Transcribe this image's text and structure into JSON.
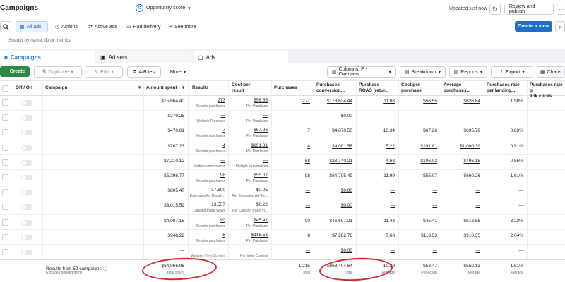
{
  "header": {
    "title": "Campaigns",
    "opportunity_badge": "72",
    "opportunity_label": "Opportunity score",
    "updated": "Updated just now",
    "review_publish": "Review and publish"
  },
  "filters": {
    "all_ads": "All ads",
    "actions": "Actions",
    "active_ads": "Active ads",
    "had_delivery": "Had delivery",
    "see_more": "See more",
    "create_view": "Create a view"
  },
  "search": {
    "placeholder": "Search by name, ID or metrics"
  },
  "tabs": {
    "campaigns": "Campaigns",
    "ad_sets": "Ad sets",
    "ads": "Ads"
  },
  "toolbar": {
    "create": "Create",
    "duplicate": "Duplicate",
    "edit": "Edit",
    "ab_test": "A/B test",
    "more": "More",
    "columns": "Columns: P - Overview",
    "breakdown": "Breakdown",
    "reports": "Reports",
    "export": "Export",
    "charts": "Charts"
  },
  "columns": {
    "off_on": "Off / On",
    "campaign": "Campaign",
    "amount_spent": "Amount spent",
    "results": "Results",
    "cost_per_result_1": "Cost per",
    "cost_per_result_2": "result",
    "purchases": "Purchases",
    "purchases_value_1": "Purchases",
    "purchases_value_2": "conversion...",
    "roas_1": "Purchase",
    "roas_2": "ROAS (retur...",
    "cost_per_purchase_1": "Cost per",
    "cost_per_purchase_2": "purchase",
    "avg_purchase_1": "Average",
    "avg_purchase_2": "purchases...",
    "rate_lp_1": "Purchases rate",
    "rate_lp_2": "per landing...",
    "rate_lc_1": "Purchases rate p",
    "rate_lc_2": "link clicks"
  },
  "rows": [
    {
      "spent": "$15,664.40",
      "results": "277",
      "results_type": "Website purchases",
      "cpr": "$56.55",
      "cpr_type": "Per Purchase",
      "purchases": "277",
      "value": "$173,634.44",
      "roas": "11.08",
      "cpp": "$56.55",
      "avg": "$626.84",
      "rate": "1.98%"
    },
    {
      "spent": "$279.25",
      "results": "—",
      "results_type": "Website Purchase",
      "cpr": "—",
      "cpr_type": "Per Purchase",
      "purchases": "—",
      "value": "$0.00",
      "roas": "—",
      "cpp": "—",
      "avg": "—",
      "rate": "—"
    },
    {
      "spent": "$470.81",
      "results": "7",
      "results_type": "Website purchases",
      "cpr": "$67.26",
      "cpr_type": "Per Purchase",
      "purchases": "7",
      "value": "$4,870.50",
      "roas": "10.34",
      "cpp": "$67.26",
      "avg": "$695.79",
      "rate": "0.83%"
    },
    {
      "spent": "$767.23",
      "results": "4",
      "results_type": "Website purchases",
      "cpr": "$191.81",
      "cpr_type": "Per Purchase",
      "purchases": "4",
      "value": "$4,001.56",
      "roas": "5.22",
      "cpp": "$191.81",
      "avg": "$1,000.39",
      "rate": "0.91%"
    },
    {
      "spent": "$7,210.12",
      "results": "—",
      "results_type": "Multiple conversions",
      "cpr": "—",
      "cpr_type": "Multiple conversions",
      "purchases": "68",
      "value": "$33,740.21",
      "roas": "4.68",
      "cpp": "$106.03",
      "avg": "$496.18",
      "rate": "0.55%"
    },
    {
      "spent": "$5,396.77",
      "results": "98",
      "results_type": "Website purchases",
      "cpr": "$55.07",
      "cpr_type": "Per Purchase",
      "purchases": "98",
      "value": "$64,705.49",
      "roas": "11.99",
      "cpp": "$55.07",
      "avg": "$660.26",
      "rate": "1.61%"
    },
    {
      "spent": "$805.47",
      "results": "17,800",
      "results_type": "Estimated Ad Recall ...",
      "cpr": "$0.05",
      "cpr_type": "Per Estimated Ad Re...",
      "purchases": "—",
      "value": "$0.00",
      "roas": "—",
      "cpp": "—",
      "avg": "—",
      "rate": "—"
    },
    {
      "spent": "$3,015.59",
      "results": "13,557",
      "results_type": "Landing Page Views",
      "cpr": "$0.22",
      "cpr_type": "Per Landing Page Vi...",
      "purchases": "—",
      "value": "$0.00",
      "roas": "—",
      "cpp": "—",
      "avg": "—",
      "rate": "—"
    },
    {
      "spent": "$4,087.15",
      "results": "90",
      "results_type": "Website purchases",
      "cpr": "$45.41",
      "cpr_type": "Per Purchase",
      "purchases": "90",
      "value": "$46,697.21",
      "roas": "11.43",
      "cpp": "$45.41",
      "avg": "$518.86",
      "rate": "3.22%"
    },
    {
      "spent": "$948.22",
      "results": "8",
      "results_type": "Website purchases",
      "cpr": "$118.53",
      "cpr_type": "Per Purchase",
      "purchases": "8",
      "value": "$7,282.78",
      "roas": "7.68",
      "cpp": "$118.53",
      "avg": "$910.35",
      "rate": "2.04%"
    },
    {
      "spent": "—",
      "results": "—",
      "results_type": "Website View Content",
      "cpr": "—",
      "cpr_type": "Per View Content",
      "purchases": "—",
      "value": "$0.00",
      "roas": "—",
      "cpp": "—",
      "avg": "—",
      "rate": "—"
    }
  ],
  "footer": {
    "results_from": "Results from 52 campaigns",
    "excludes": "Excludes deleted items",
    "spent": "$64,966.96",
    "spent_label": "Total Spent",
    "results": "—",
    "cpr": "—",
    "purchases": "1,215",
    "purchases_label": "Total",
    "value": "$668,404.64",
    "value_label": "Total",
    "roas": "10.29",
    "roas_label": "Average",
    "cpp": "$53.47",
    "cpp_label": "Per Action",
    "avg": "$550.13",
    "avg_label": "Average",
    "rate": "1.51%",
    "rate_label": "Average"
  }
}
